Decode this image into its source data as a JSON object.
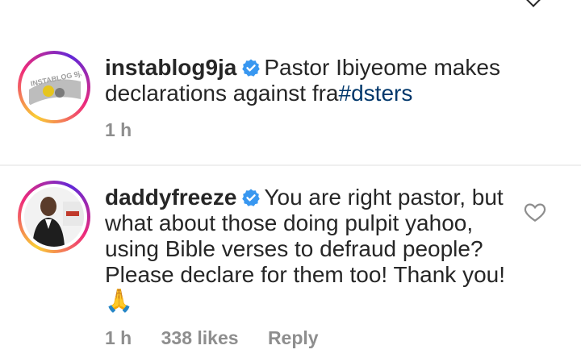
{
  "post_caption": {
    "username": "instablog9ja",
    "text": "Pastor Ibiyeome makes declarations against fra",
    "hashtag": "#dsters",
    "time": "1 h",
    "avatar_logo_text": "INSTABLOG 9ja"
  },
  "comment": {
    "username": "daddyfreeze",
    "text": "You are right pastor, but what about those doing pulpit yahoo, using Bible verses to defraud people? Please declare for them too! Thank you!",
    "emoji": "🙏",
    "time": "1 h",
    "likes": "338 likes",
    "reply_label": "Reply"
  },
  "icons": {
    "verified": "verified-badge-icon",
    "like": "heart-outline-icon",
    "top": "chevron-down-icon"
  },
  "colors": {
    "verified": "#3897f0",
    "hashtag": "#00376b",
    "meta": "#8e8e8e",
    "text": "#262626"
  }
}
